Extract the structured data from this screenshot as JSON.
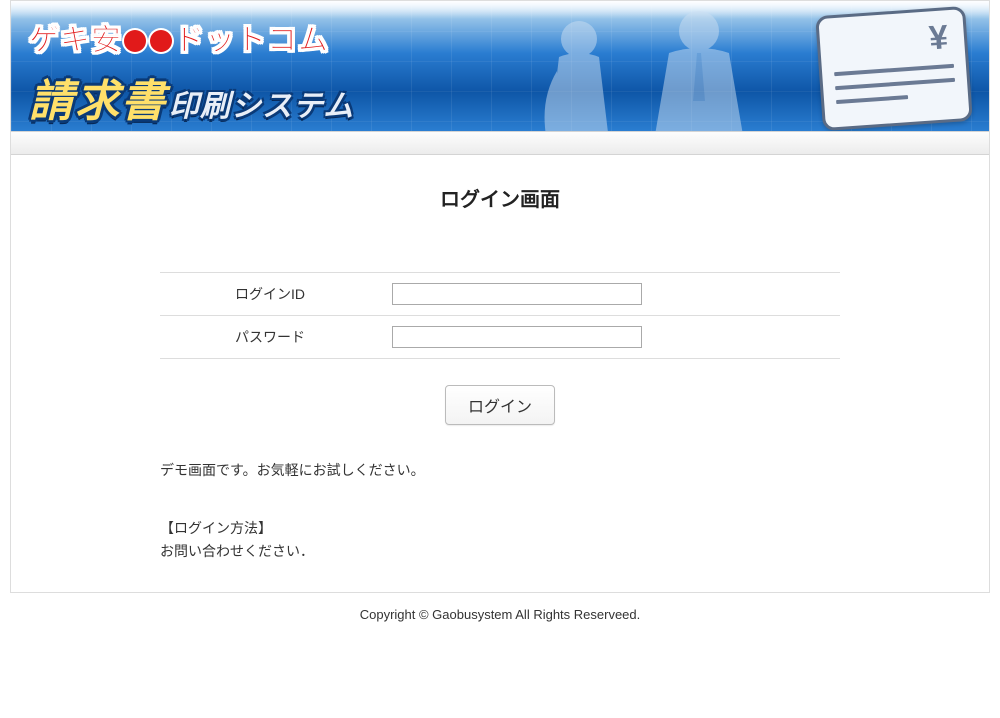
{
  "banner": {
    "line1_part1": "ゲキ安",
    "line1_part2": "ドットコム",
    "line2_big": "請求書",
    "line2_small": "印刷システム",
    "yen_symbol": "¥"
  },
  "page": {
    "title": "ログイン画面"
  },
  "form": {
    "login_id_label": "ログインID",
    "login_id_value": "",
    "password_label": "パスワード",
    "password_value": "",
    "submit_label": "ログイン"
  },
  "info": {
    "demo_text": "デモ画面です。お気軽にお試しください。",
    "login_method_heading": "【ログイン方法】",
    "login_method_text": "お問い合わせください．"
  },
  "footer": {
    "copyright": "Copyright © Gaobusystem All Rights Reserveed."
  }
}
